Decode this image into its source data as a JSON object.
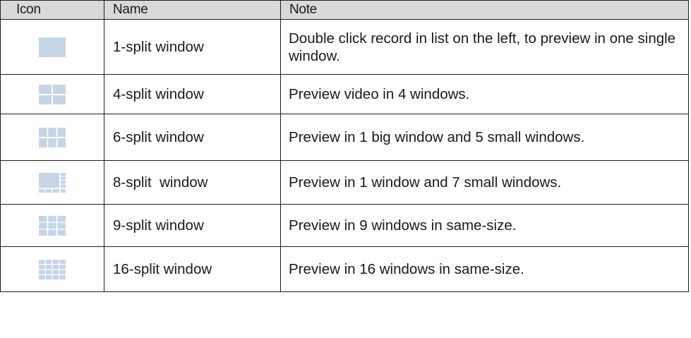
{
  "headers": {
    "icon": "Icon",
    "name": "Name",
    "note": "Note"
  },
  "icon_color": "#c5d5e6",
  "rows": [
    {
      "icon": "1-split-layout-icon",
      "name": "1-split window",
      "note": "Double click record in list on the left, to preview in one single window."
    },
    {
      "icon": "4-split-layout-icon",
      "name": "4-split window",
      "note": "Preview video in 4 windows."
    },
    {
      "icon": "6-split-layout-icon",
      "name": "6-split window",
      "note": "Preview in 1 big window and 5 small windows."
    },
    {
      "icon": "8-split-layout-icon",
      "name": "8-split  window",
      "note": "Preview in 1 window and 7 small windows."
    },
    {
      "icon": "9-split-layout-icon",
      "name": "9-split window",
      "note": "Preview in 9 windows in same-size."
    },
    {
      "icon": "16-split-layout-icon",
      "name": "16-split window",
      "note": "Preview in 16 windows in same-size."
    }
  ]
}
